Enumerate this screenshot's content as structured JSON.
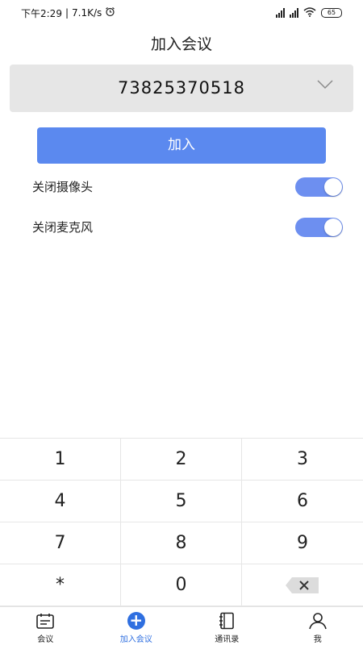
{
  "status_bar": {
    "time": "下午2:29",
    "speed": "7.1K/s",
    "separator": "|",
    "battery": "65"
  },
  "header": {
    "title": "加入会议"
  },
  "meeting_number": {
    "value": "73825370518"
  },
  "join_button": {
    "label": "加入"
  },
  "toggles": [
    {
      "label": "关闭摄像头",
      "on": true
    },
    {
      "label": "关闭麦克风",
      "on": true
    }
  ],
  "keypad": {
    "keys": [
      "1",
      "2",
      "3",
      "4",
      "5",
      "6",
      "7",
      "8",
      "9",
      "*",
      "0"
    ]
  },
  "tabbar": {
    "items": [
      {
        "label": "会议",
        "icon": "calendar-icon"
      },
      {
        "label": "加入会议",
        "icon": "plus-circle-icon",
        "active": true
      },
      {
        "label": "通讯录",
        "icon": "contacts-book-icon"
      },
      {
        "label": "我",
        "icon": "person-icon"
      }
    ]
  },
  "colors": {
    "accent": "#5b89ef",
    "tab_active": "#2f6fe0",
    "switch_on": "#6d8ff0"
  }
}
